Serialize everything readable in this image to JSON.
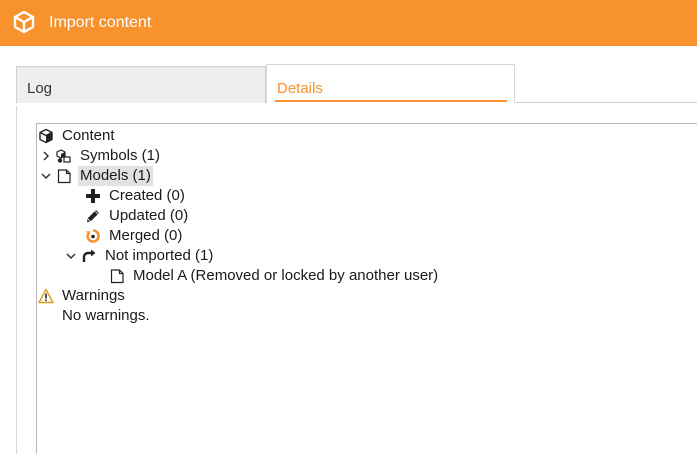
{
  "window": {
    "title": "Import content"
  },
  "tabs": {
    "log": "Log",
    "details": "Details"
  },
  "tree": {
    "content": "Content",
    "symbols": "Symbols (1)",
    "models": "Models (1)",
    "created": "Created (0)",
    "updated": "Updated (0)",
    "merged": "Merged (0)",
    "not_imported": "Not imported (1)",
    "model_a": "Model A (Removed or locked by another user)",
    "warnings": "Warnings",
    "no_warnings": "No warnings."
  },
  "colors": {
    "accent": "#f7922c"
  }
}
